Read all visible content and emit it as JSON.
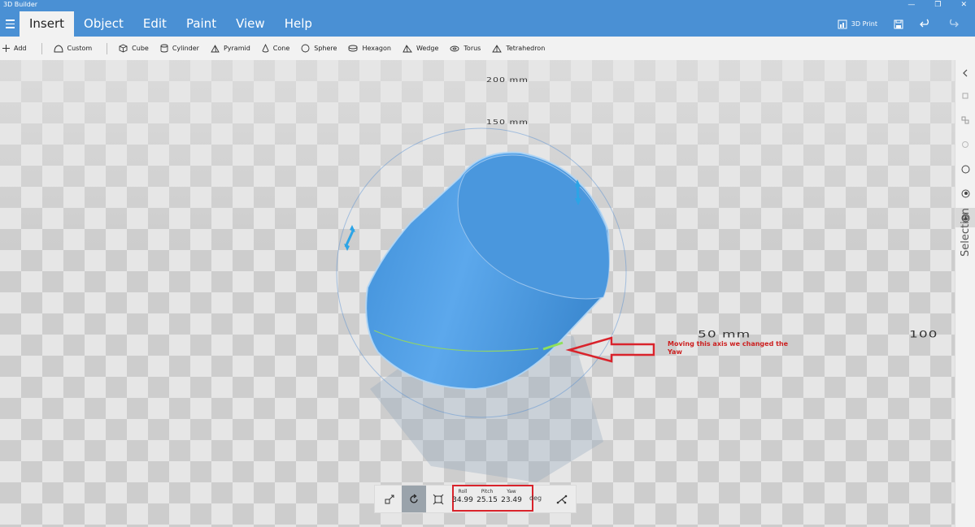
{
  "window": {
    "title": "3D Builder"
  },
  "menu": {
    "tabs": [
      "Insert",
      "Object",
      "Edit",
      "Paint",
      "View",
      "Help"
    ],
    "active": 0,
    "print_label": "3D Print"
  },
  "toolbar": {
    "add": "Add",
    "custom": "Custom",
    "shapes": [
      "Cube",
      "Cylinder",
      "Pyramid",
      "Cone",
      "Sphere",
      "Hexagon",
      "Wedge",
      "Torus",
      "Tetrahedron"
    ]
  },
  "viewport": {
    "labels": {
      "l200": "200 mm",
      "l150": "150 mm",
      "l50": "50 mm",
      "l100": "100"
    },
    "annotation": "Moving this axis we changed the Yaw"
  },
  "rotation": {
    "roll_label": "Roll",
    "roll_value": "34.99",
    "pitch_label": "Pitch",
    "pitch_value": "25.15",
    "yaw_label": "Yaw",
    "yaw_value": "23.49",
    "unit": "deg"
  },
  "rightrail": {
    "label": "Selection"
  },
  "icons": {
    "titlebar": [
      "minimize-icon",
      "maximize-icon",
      "close-icon"
    ],
    "menu": [
      "hamburger-icon",
      "print-icon",
      "save-icon",
      "undo-icon",
      "redo-icon"
    ],
    "toolbar": [
      "plus-icon",
      "custom-shape-icon",
      "cube-icon",
      "cylinder-icon",
      "pyramid-icon",
      "cone-icon",
      "sphere-icon",
      "hexagon-icon",
      "wedge-icon",
      "torus-icon",
      "tetrahedron-icon"
    ],
    "rotation": [
      "move-icon",
      "rotate-icon",
      "scale-icon",
      "gizmo-icon"
    ],
    "rightrail": [
      "chevron-left-icon",
      "selection-icon"
    ]
  },
  "colors": {
    "accent": "#4a90d4",
    "object": "#4a97dd",
    "highlight": "#d9232b"
  }
}
